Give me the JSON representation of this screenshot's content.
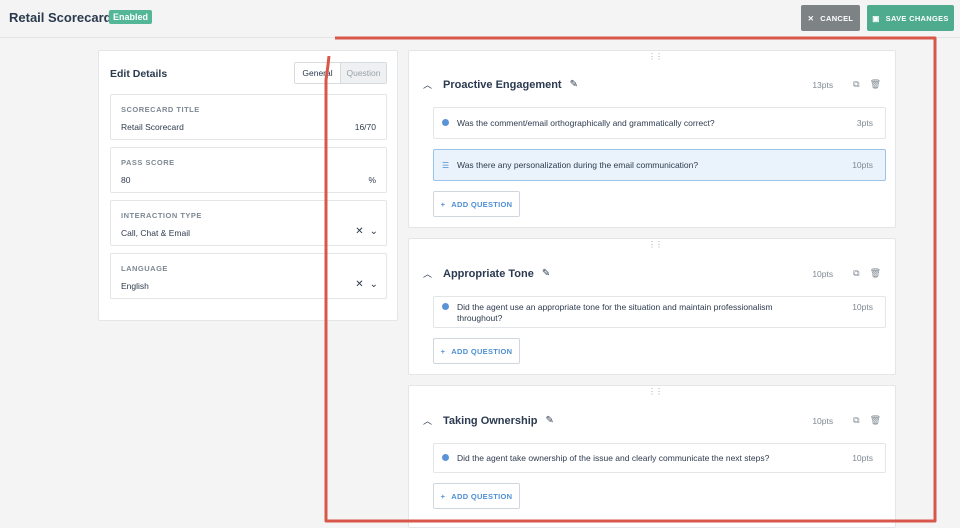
{
  "header": {
    "title": "Retail Scorecard",
    "badge": "Enabled",
    "cancel_label": "CANCEL",
    "save_label": "SAVE CHANGES"
  },
  "edit": {
    "title": "Edit Details",
    "tabs": [
      "General",
      "Question"
    ],
    "active_tab": "General",
    "fields": [
      {
        "label": "SCORECARD TITLE",
        "value": "Retail Scorecard",
        "suffix": "16/70"
      },
      {
        "label": "PASS SCORE",
        "value": "80",
        "suffix": "%"
      },
      {
        "label": "INTERACTION TYPE",
        "value": "Call, Chat & Email"
      },
      {
        "label": "LANGUAGE",
        "value": "English"
      }
    ]
  },
  "sections": [
    {
      "title": "Proactive Engagement",
      "points": "13pts",
      "add_label": "ADD QUESTION",
      "questions": [
        {
          "text": "Was the comment/email orthographically and grammatically correct?",
          "points": "3pts",
          "icon": "dot-icon"
        },
        {
          "text": "Was there any personalization during the email communication?",
          "points": "10pts",
          "icon": "list-icon"
        }
      ]
    },
    {
      "title": "Appropriate Tone",
      "points": "10pts",
      "add_label": "ADD QUESTION",
      "questions": [
        {
          "text": "Did the agent use an appropriate tone for the situation and maintain professionalism throughout?",
          "points": "10pts",
          "icon": "dot-icon"
        }
      ]
    },
    {
      "title": "Taking Ownership",
      "points": "10pts",
      "add_label": "ADD QUESTION",
      "questions": [
        {
          "text": "Did the agent take ownership of the issue and clearly communicate the next steps?",
          "points": "10pts",
          "icon": "dot-icon"
        }
      ]
    }
  ],
  "colors": {
    "accent": "#4fab8e",
    "badge": "#53b797",
    "highlight": "#eaf3fb",
    "annotation": "#d9574a"
  }
}
